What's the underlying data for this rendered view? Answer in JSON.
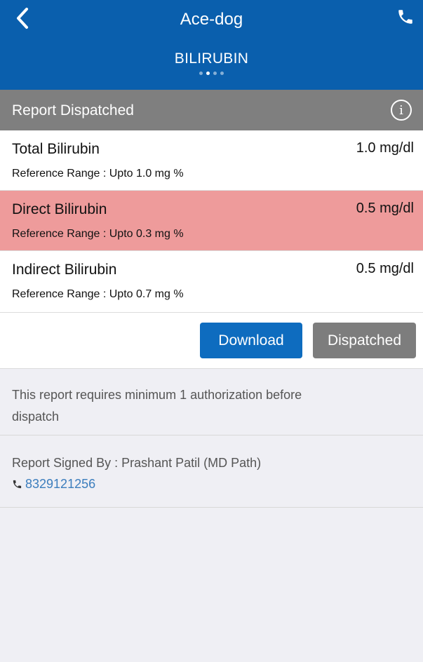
{
  "header": {
    "title": "Ace-dog",
    "subtitle": "BILIRUBIN",
    "back_icon": "chevron-left-icon",
    "call_icon": "phone-icon"
  },
  "status": {
    "text": "Report Dispatched",
    "info_icon": "info-icon"
  },
  "results": [
    {
      "name": "Total Bilirubin",
      "value": "1.0 mg/dl",
      "range": "Reference Range : Upto 1.0 mg %",
      "abnormal": false
    },
    {
      "name": "Direct Bilirubin",
      "value": "0.5 mg/dl",
      "range": "Reference Range : Upto 0.3 mg %",
      "abnormal": true
    },
    {
      "name": "Indirect Bilirubin",
      "value": "0.5 mg/dl",
      "range": "Reference Range : Upto 0.7 mg %",
      "abnormal": false
    }
  ],
  "actions": {
    "download": "Download",
    "dispatched": "Dispatched"
  },
  "note": "This report requires minimum 1 authorization before dispatch",
  "signature": {
    "text": "Report Signed By :  Prashant Patil (MD Path)",
    "phone": "8329121256"
  },
  "colors": {
    "header": "#0a5fad",
    "status_bar": "#7f7f7f",
    "abnormal_row": "#ee9b9b",
    "download_button": "#0e6cbf",
    "dispatched_button": "#7d7d7d",
    "link": "#3b7dbd"
  }
}
